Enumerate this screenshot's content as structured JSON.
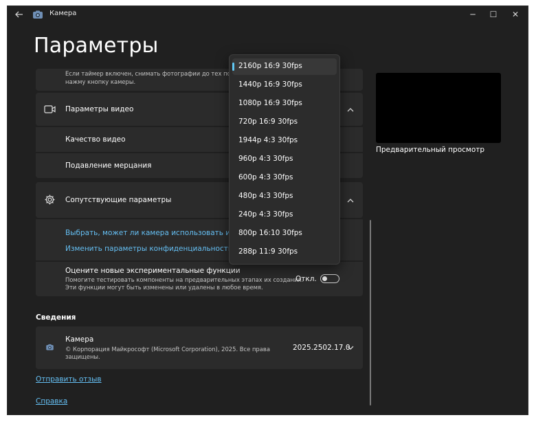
{
  "window": {
    "title": "Камера",
    "controls": {
      "minimize": "─",
      "maximize": "☐",
      "close": "✕"
    }
  },
  "page": {
    "title": "Параметры"
  },
  "timer_hint": {
    "line1": "Если таймер включен, снимать фотографии до тех пор, по",
    "line2": "нажму кнопку камеры."
  },
  "video_settings": {
    "title": "Параметры видео",
    "items": [
      {
        "label": "Качество видео"
      },
      {
        "label": "Подавление мерцания"
      }
    ]
  },
  "related_settings": {
    "title": "Сопутствующие параметры",
    "links": [
      "Выбрать, может ли камера использовать информ",
      "Изменить параметры конфиденциальности"
    ]
  },
  "experimental": {
    "title": "Оцените новые экспериментальные функции",
    "desc_line1": "Помогите тестировать компоненты на предварительных этапах их создания.",
    "desc_line2": "Эти функции могут быть изменены или удалены в любое время.",
    "toggle_label": "Откл.",
    "toggle_on": false
  },
  "about": {
    "section_title": "Сведения",
    "app_name": "Камера",
    "copyright_line1": "© Корпорация Майкрософт (Microsoft Corporation), 2025. Все права",
    "copyright_line2": "защищены.",
    "version": "2025.2502.17.0"
  },
  "footer_links": {
    "feedback": "Отправить отзыв",
    "help": "Справка"
  },
  "preview": {
    "label": "Предварительный просмотр"
  },
  "resolution_dropdown": {
    "selected_index": 0,
    "options": [
      "2160p 16:9 30fps",
      "1440p 16:9 30fps",
      "1080p 16:9 30fps",
      "720p 16:9 30fps",
      "1944p 4:3 30fps",
      "960p 4:3 30fps",
      "600p 4:3 30fps",
      "480p 4:3 30fps",
      "240p 4:3 30fps",
      "800p 16:10 30fps",
      "288p 11:9 30fps"
    ]
  },
  "icons": {
    "back": "back-arrow-icon",
    "app": "camera-app-icon",
    "video": "video-camera-icon",
    "settings": "gear-icon",
    "about": "camera-app-icon",
    "expand": "chevron-up-icon",
    "collapse": "chevron-down-icon"
  },
  "colors": {
    "background": "#202020",
    "card": "#2b2b2b",
    "accent": "#60c7f3",
    "link": "#65bff3"
  }
}
